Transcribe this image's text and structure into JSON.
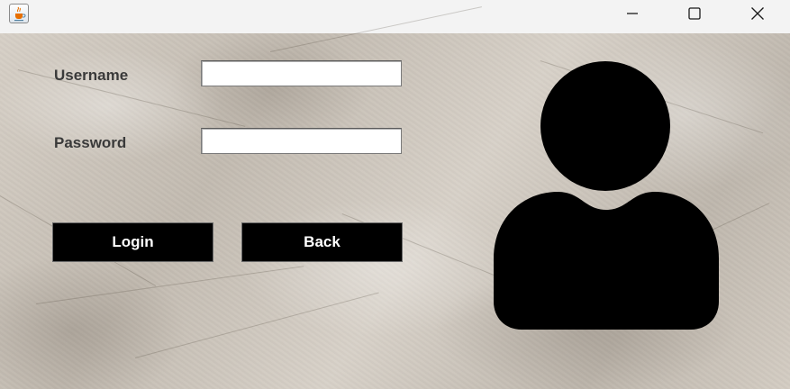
{
  "window": {
    "app_icon": "java-cup-icon",
    "controls": {
      "minimize_icon": "minimize-icon",
      "maximize_icon": "maximize-icon",
      "close_icon": "close-icon"
    }
  },
  "form": {
    "username_label": "Username",
    "username_value": "",
    "password_label": "Password",
    "password_value": "",
    "login_label": "Login",
    "back_label": "Back"
  },
  "illustration": {
    "icon": "user-avatar-icon"
  },
  "colors": {
    "button_background": "#000000",
    "button_text": "#ffffff",
    "label_text": "#3a3a3a",
    "background_paper": "#cfc7bc"
  }
}
